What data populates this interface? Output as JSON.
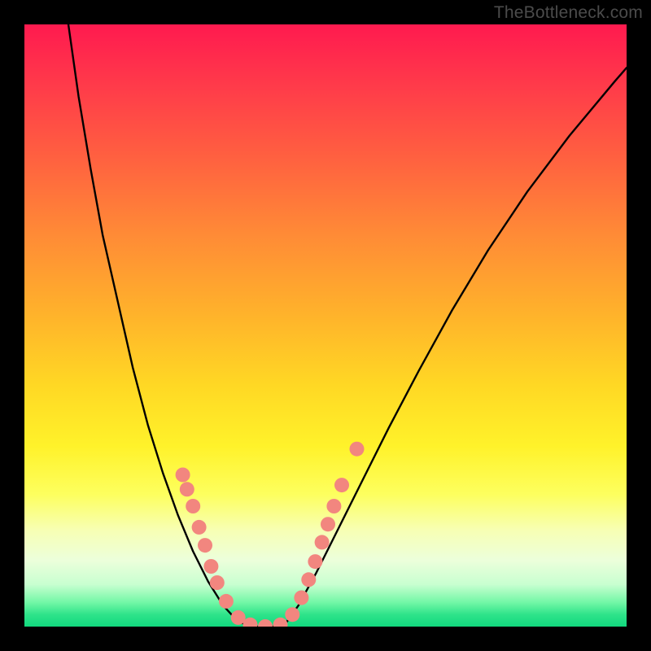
{
  "watermark": "TheBottleneck.com",
  "colors": {
    "curve": "#000000",
    "marker_fill": "#f2867f",
    "marker_stroke": "#e46a63",
    "background_black": "#000000"
  },
  "chart_data": {
    "type": "line",
    "title": "",
    "xlabel": "",
    "ylabel": "",
    "xlim": [
      0,
      1
    ],
    "ylim": [
      0,
      1
    ],
    "curve": {
      "left_branch": [
        {
          "x": 0.073,
          "y": 1.0
        },
        {
          "x": 0.09,
          "y": 0.88
        },
        {
          "x": 0.11,
          "y": 0.76
        },
        {
          "x": 0.13,
          "y": 0.65
        },
        {
          "x": 0.155,
          "y": 0.54
        },
        {
          "x": 0.18,
          "y": 0.43
        },
        {
          "x": 0.205,
          "y": 0.335
        },
        {
          "x": 0.23,
          "y": 0.255
        },
        {
          "x": 0.255,
          "y": 0.185
        },
        {
          "x": 0.28,
          "y": 0.125
        },
        {
          "x": 0.305,
          "y": 0.075
        },
        {
          "x": 0.33,
          "y": 0.035
        },
        {
          "x": 0.355,
          "y": 0.008
        },
        {
          "x": 0.38,
          "y": 0.0
        }
      ],
      "floor": [
        {
          "x": 0.38,
          "y": 0.0
        },
        {
          "x": 0.43,
          "y": 0.0
        }
      ],
      "right_branch": [
        {
          "x": 0.43,
          "y": 0.0
        },
        {
          "x": 0.455,
          "y": 0.035
        },
        {
          "x": 0.485,
          "y": 0.09
        },
        {
          "x": 0.52,
          "y": 0.16
        },
        {
          "x": 0.56,
          "y": 0.24
        },
        {
          "x": 0.605,
          "y": 0.33
        },
        {
          "x": 0.655,
          "y": 0.425
        },
        {
          "x": 0.71,
          "y": 0.525
        },
        {
          "x": 0.77,
          "y": 0.625
        },
        {
          "x": 0.835,
          "y": 0.722
        },
        {
          "x": 0.905,
          "y": 0.815
        },
        {
          "x": 0.98,
          "y": 0.905
        },
        {
          "x": 1.0,
          "y": 0.928
        }
      ]
    },
    "markers": [
      {
        "x": 0.263,
        "y": 0.252
      },
      {
        "x": 0.27,
        "y": 0.228
      },
      {
        "x": 0.28,
        "y": 0.2
      },
      {
        "x": 0.29,
        "y": 0.165
      },
      {
        "x": 0.3,
        "y": 0.135
      },
      {
        "x": 0.31,
        "y": 0.1
      },
      {
        "x": 0.32,
        "y": 0.073
      },
      {
        "x": 0.335,
        "y": 0.042
      },
      {
        "x": 0.355,
        "y": 0.015
      },
      {
        "x": 0.375,
        "y": 0.003
      },
      {
        "x": 0.4,
        "y": 0.0
      },
      {
        "x": 0.425,
        "y": 0.003
      },
      {
        "x": 0.445,
        "y": 0.02
      },
      {
        "x": 0.46,
        "y": 0.048
      },
      {
        "x": 0.472,
        "y": 0.078
      },
      {
        "x": 0.483,
        "y": 0.108
      },
      {
        "x": 0.494,
        "y": 0.14
      },
      {
        "x": 0.504,
        "y": 0.17
      },
      {
        "x": 0.514,
        "y": 0.2
      },
      {
        "x": 0.527,
        "y": 0.235
      },
      {
        "x": 0.552,
        "y": 0.295
      }
    ],
    "marker_radius_px": 9
  }
}
